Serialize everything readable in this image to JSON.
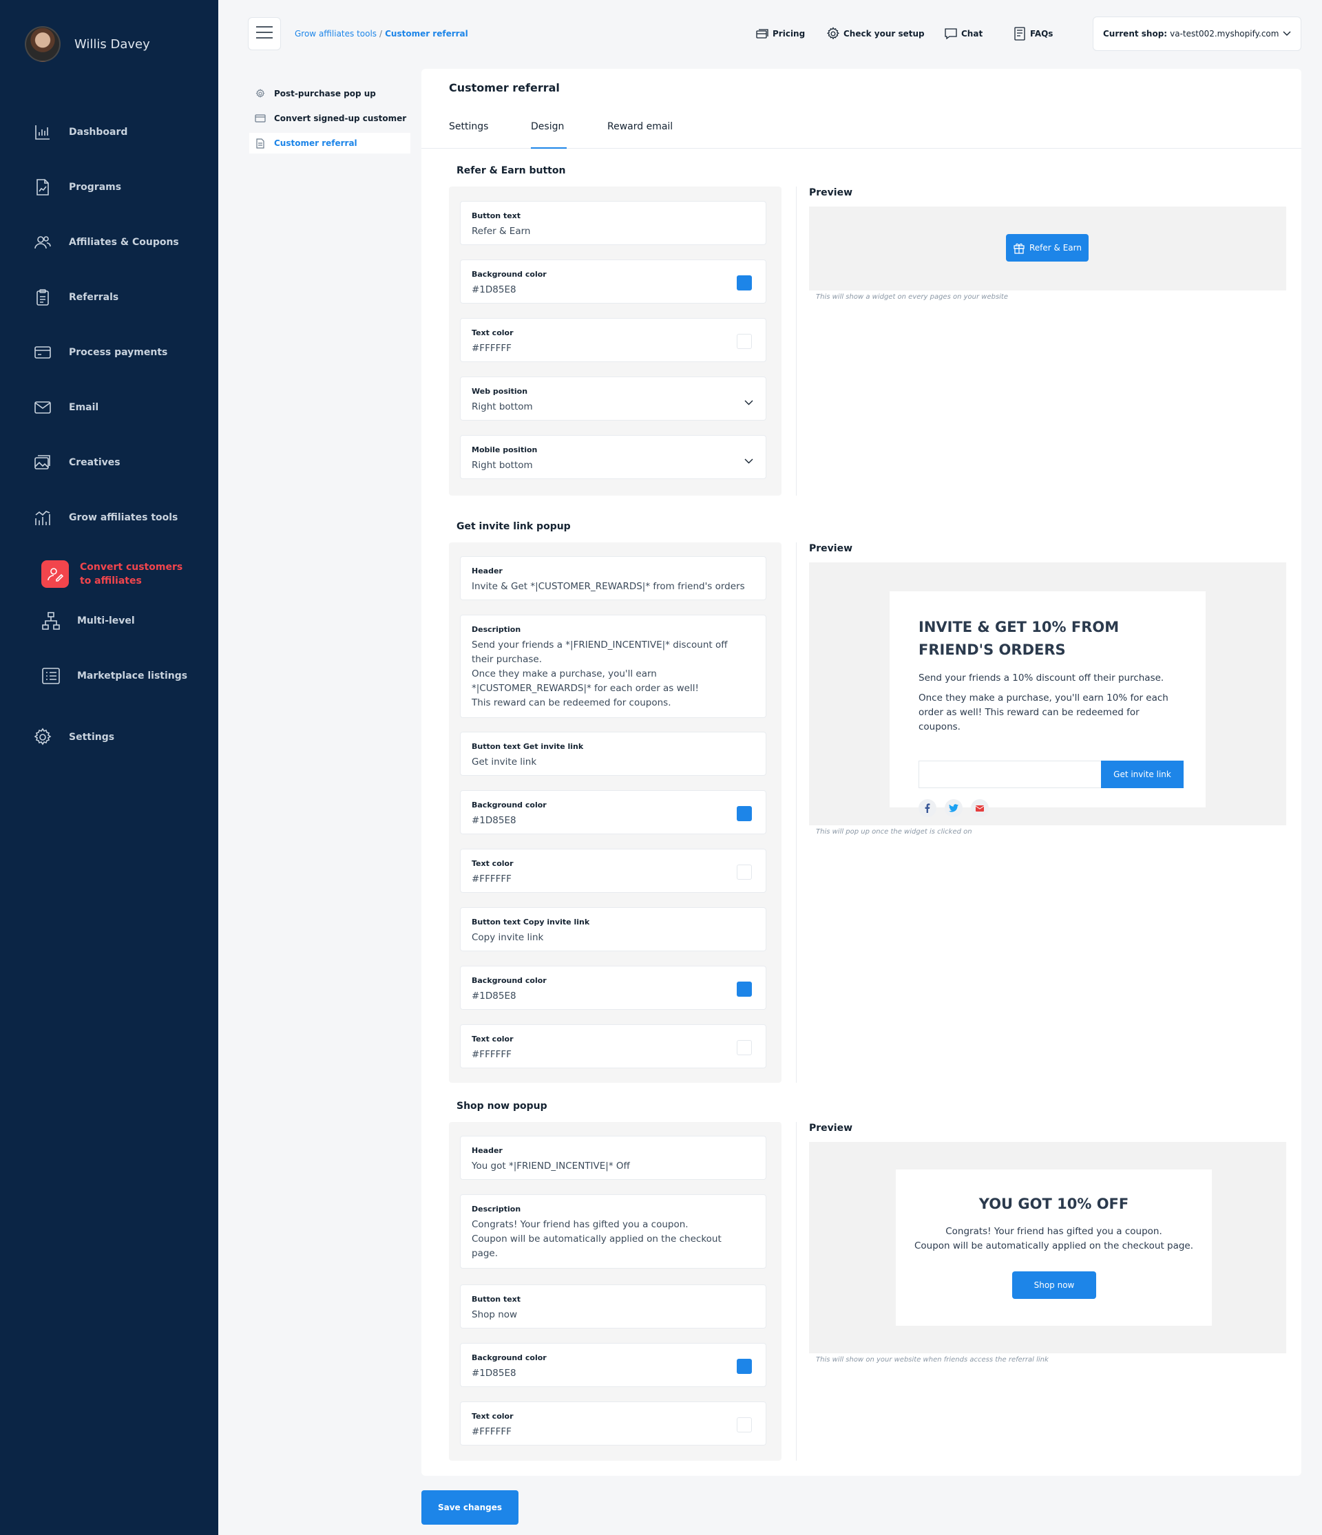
{
  "user": {
    "name": "Willis Davey"
  },
  "sidebar": {
    "items": [
      {
        "label": "Dashboard",
        "icon": "bar-chart-icon"
      },
      {
        "label": "Programs",
        "icon": "document-chart-icon"
      },
      {
        "label": "Affiliates & Coupons",
        "icon": "users-icon"
      },
      {
        "label": "Referrals",
        "icon": "clipboard-icon"
      },
      {
        "label": "Process payments",
        "icon": "credit-card-icon"
      },
      {
        "label": "Email",
        "icon": "mail-icon"
      },
      {
        "label": "Creatives",
        "icon": "images-icon"
      },
      {
        "label": "Grow affiliates tools",
        "icon": "growth-chart-icon"
      },
      {
        "label": "Convert customers to affiliates",
        "icon": "user-edit-icon"
      },
      {
        "label": "Multi-level",
        "icon": "hierarchy-icon"
      },
      {
        "label": "Marketplace listings",
        "icon": "list-icon"
      },
      {
        "label": "Settings",
        "icon": "gear-icon"
      }
    ]
  },
  "breadcrumb": {
    "parent": "Grow affiliates tools",
    "separator": "/",
    "current": "Customer referral"
  },
  "topbar": {
    "pricing": "Pricing",
    "check_setup": "Check your setup",
    "chat": "Chat",
    "faqs": "FAQs",
    "shop_label": "Current shop:",
    "shop_value": "va-test002.myshopify.com"
  },
  "subnav": {
    "items": [
      {
        "label": "Post-purchase pop up"
      },
      {
        "label": "Convert signed-up customer"
      },
      {
        "label": "Customer referral"
      }
    ]
  },
  "page": {
    "title": "Customer referral",
    "tabs": [
      "Settings",
      "Design",
      "Reward email"
    ],
    "active_tab": "Design"
  },
  "colors": {
    "accent": "#1D85E8",
    "sidebar": "#0B2545",
    "active_nav": "#F2454C"
  },
  "refer_section": {
    "title": "Refer & Earn button",
    "fields": [
      {
        "label": "Button text",
        "value": "Refer & Earn"
      },
      {
        "label": "Background color",
        "value": "#1D85E8"
      },
      {
        "label": "Text color",
        "value": "#FFFFFF"
      },
      {
        "label": "Web position",
        "value": "Right bottom"
      },
      {
        "label": "Mobile position",
        "value": "Right bottom"
      }
    ],
    "preview_title": "Preview",
    "preview_button": "Refer & Earn",
    "note": "This will show a widget on every pages on your website"
  },
  "invite_section": {
    "title": "Get invite link popup",
    "fields": [
      {
        "label": "Header",
        "value": "Invite & Get *|CUSTOMER_REWARDS|* from friend's orders"
      },
      {
        "label": "Description",
        "value": "Send your friends a *|FRIEND_INCENTIVE|* discount off\ntheir purchase.\nOnce they make a purchase, you'll earn\n*|CUSTOMER_REWARDS|* for each order as well!\nThis reward can be redeemed for coupons."
      },
      {
        "label": "Button text Get invite link",
        "value": "Get invite link"
      },
      {
        "label": "Background color",
        "value": "#1D85E8"
      },
      {
        "label": "Text color",
        "value": "#FFFFFF"
      },
      {
        "label": "Button text Copy invite link",
        "value": "Copy invite link"
      },
      {
        "label": "Background color",
        "value": "#1D85E8"
      },
      {
        "label": "Text color",
        "value": "#FFFFFF"
      }
    ],
    "preview_title": "Preview",
    "preview_header": "INVITE & GET 10% FROM FRIEND'S ORDERS",
    "preview_desc_1": "Send your friends a 10% discount off their purchase.",
    "preview_desc_2": "Once they make a purchase, you'll earn 10% for each order as well! This reward can be redeemed for coupons.",
    "preview_button": "Get invite link",
    "note": "This will pop up once the widget is clicked on"
  },
  "shop_section": {
    "title": "Shop now popup",
    "fields": [
      {
        "label": "Header",
        "value": "You got *|FRIEND_INCENTIVE|* Off"
      },
      {
        "label": "Description",
        "value": "Congrats! Your friend has gifted you a coupon.\nCoupon will be automatically applied on the checkout\npage."
      },
      {
        "label": "Button text",
        "value": "Shop now"
      },
      {
        "label": "Background color",
        "value": "#1D85E8"
      },
      {
        "label": "Text color",
        "value": "#FFFFFF"
      }
    ],
    "preview_title": "Preview",
    "preview_header": "YOU GOT 10% OFF",
    "preview_desc": "Congrats! Your friend has gifted you a coupon.\nCoupon will be automatically applied on the checkout page.",
    "preview_button": "Shop now",
    "note": "This will show on your website when friends access the referral link"
  },
  "actions": {
    "save": "Save changes"
  }
}
